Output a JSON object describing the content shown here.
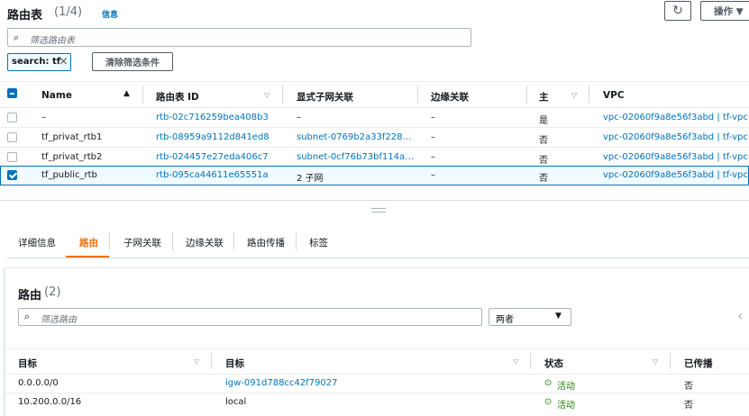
{
  "header": {
    "title": "路由表",
    "count": "(1/4)",
    "info": "信息",
    "refresh_icon": "refresh-icon",
    "actions_label": "操作 ▼"
  },
  "filter": {
    "placeholder": "筛选路由表",
    "token_label": "search: tf",
    "clear_label": "清除筛选条件"
  },
  "table": {
    "columns": [
      "Name",
      "路由表 ID",
      "显式子网关联",
      "边缘关联",
      "主",
      "VPC"
    ],
    "rows": [
      {
        "name": "–",
        "id": "rtb-02c716259bea408b3",
        "subnet": "–",
        "edge": "–",
        "main": "是",
        "vpc": "vpc-02060f9a8e56f3abd | tf-vpc",
        "checked": false
      },
      {
        "name": "tf_privat_rtb1",
        "id": "rtb-08959a9112d841ed8",
        "subnet": "subnet-0769b2a33f228…",
        "edge": "–",
        "main": "否",
        "vpc": "vpc-02060f9a8e56f3abd | tf-vpc",
        "checked": false
      },
      {
        "name": "tf_privat_rtb2",
        "id": "rtb-024457e27eda406c7",
        "subnet": "subnet-0cf76b73bf114a…",
        "edge": "–",
        "main": "否",
        "vpc": "vpc-02060f9a8e56f3abd | tf-vpc",
        "checked": false
      },
      {
        "name": "tf_public_rtb",
        "id": "rtb-095ca44611e65551a",
        "subnet": "2 子网",
        "edge": "–",
        "main": "否",
        "vpc": "vpc-02060f9a8e56f3abd | tf-vpc",
        "checked": true
      }
    ]
  },
  "tabs": [
    "详细信息",
    "路由",
    "子网关联",
    "边缘关联",
    "路由传播",
    "标签"
  ],
  "active_tab": "路由",
  "routes": {
    "title": "路由",
    "count": "(2)",
    "filter_placeholder": "筛选路由",
    "select_value": "两者",
    "columns": [
      "目标",
      "目标",
      "状态",
      "已传播"
    ],
    "rows": [
      {
        "destination": "0.0.0.0/0",
        "target": "igw-091d788cc42f79027",
        "status": "活动",
        "propagated": "否"
      },
      {
        "destination": "10.200.0.0/16",
        "target": "local",
        "status": "活动",
        "propagated": "否"
      }
    ]
  },
  "colors": {
    "link": "#0073bb",
    "active_tab": "#ec7211",
    "status_ok": "#1d8102"
  }
}
